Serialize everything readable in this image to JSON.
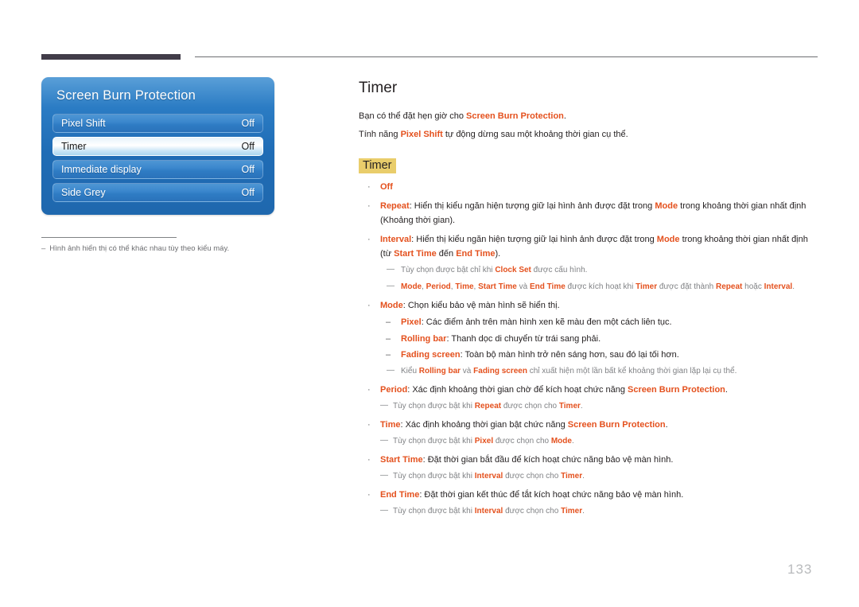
{
  "page": {
    "number": "133",
    "title": "Timer"
  },
  "osd": {
    "title": "Screen Burn Protection",
    "rows": [
      {
        "label": "Pixel Shift",
        "value": "Off",
        "selected": false
      },
      {
        "label": "Timer",
        "value": "Off",
        "selected": true
      },
      {
        "label": "Immediate display",
        "value": "Off",
        "selected": false
      },
      {
        "label": "Side Grey",
        "value": "Off",
        "selected": false
      }
    ]
  },
  "figure_note": {
    "marker": "–",
    "text": "Hình ảnh hiển thị có thể khác nhau tùy theo kiểu máy."
  },
  "intro": {
    "line1_a": "Bạn có thể đặt hẹn giờ cho ",
    "line1_em": "Screen Burn Protection",
    "line1_b": ".",
    "line2_a": "Tính năng ",
    "line2_em": "Pixel Shift",
    "line2_b": " tự động dừng sau một khoảng thời gian cụ thể."
  },
  "sub_head": "Timer",
  "markers": {
    "bullet": "·",
    "dash": "–",
    "note": "—"
  },
  "items": {
    "off": {
      "term": "Off"
    },
    "repeat": {
      "term": "Repeat",
      "rest_a": ": Hiển thị kiểu ngăn hiện tượng giữ lại hình ảnh được đặt trong ",
      "em1": "Mode",
      "rest_b": " trong khoảng thời gian nhất định (Khoảng thời gian)."
    },
    "interval": {
      "term": "Interval",
      "rest_a": ": Hiển thị kiểu ngăn hiện tượng giữ lại hình ảnh được đặt trong ",
      "em1": "Mode",
      "rest_b": " trong khoảng thời gian nhất định (từ ",
      "em2": "Start Time",
      "rest_c": " đến ",
      "em3": "End Time",
      "rest_d": ")."
    },
    "note_clock": {
      "a": "Tùy chọn được bật chỉ khi ",
      "em1": "Clock Set",
      "b": " được cấu hình."
    },
    "note_activated": {
      "em1": "Mode",
      "a": ", ",
      "em2": "Period",
      "b": ", ",
      "em3": "Time",
      "c": ", ",
      "em4": "Start Time",
      "d": " và ",
      "em5": "End Time",
      "e": " được kích hoạt khi ",
      "em6": "Timer",
      "f": " được đặt thành ",
      "em7": "Repeat",
      "g": " hoặc ",
      "em8": "Interval",
      "h": "."
    },
    "mode": {
      "term": "Mode",
      "rest": ": Chọn kiểu bảo vệ màn hình sẽ hiển thị."
    },
    "mode_subs": [
      {
        "term": "Pixel",
        "rest": ": Các điểm ảnh trên màn hình xen kẽ màu đen một cách liên tục."
      },
      {
        "term": "Rolling bar",
        "rest": ": Thanh dọc di chuyển từ trái sang phải."
      },
      {
        "term": "Fading screen",
        "rest": ": Toàn bộ màn hình trở nên sáng hơn, sau đó lại tối hơn."
      }
    ],
    "note_rolling": {
      "a": "Kiểu ",
      "em1": "Rolling bar",
      "b": " và ",
      "em2": "Fading screen",
      "c": " chỉ xuất hiện một lần bất kể khoảng thời gian lặp lại cụ thể."
    },
    "period": {
      "term": "Period",
      "rest_a": ": Xác định khoảng thời gian chờ để kích hoạt chức năng ",
      "em1": "Screen Burn Protection",
      "rest_b": "."
    },
    "note_period": {
      "a": "Tùy chọn được bật khi ",
      "em1": "Repeat",
      "b": " được chọn cho ",
      "em2": "Timer",
      "c": "."
    },
    "time": {
      "term": "Time",
      "rest_a": ": Xác định khoảng thời gian bật chức năng ",
      "em1": "Screen Burn Protection",
      "rest_b": "."
    },
    "note_time": {
      "a": "Tùy chọn được bật khi ",
      "em1": "Pixel",
      "b": " được chọn cho ",
      "em2": "Mode",
      "c": "."
    },
    "start_time": {
      "term": "Start Time",
      "rest": ": Đặt thời gian bắt đầu để kích hoạt chức năng bảo vệ màn hình."
    },
    "note_start": {
      "a": "Tùy chọn được bật khi ",
      "em1": "Interval",
      "b": " được chọn cho ",
      "em2": "Timer",
      "c": "."
    },
    "end_time": {
      "term": "End Time",
      "rest": ": Đặt thời gian kết thúc để tắt kích hoạt chức năng bảo vệ màn hình."
    },
    "note_end": {
      "a": "Tùy chọn được bật khi ",
      "em1": "Interval",
      "b": " được chọn cho ",
      "em2": "Timer",
      "c": "."
    }
  }
}
